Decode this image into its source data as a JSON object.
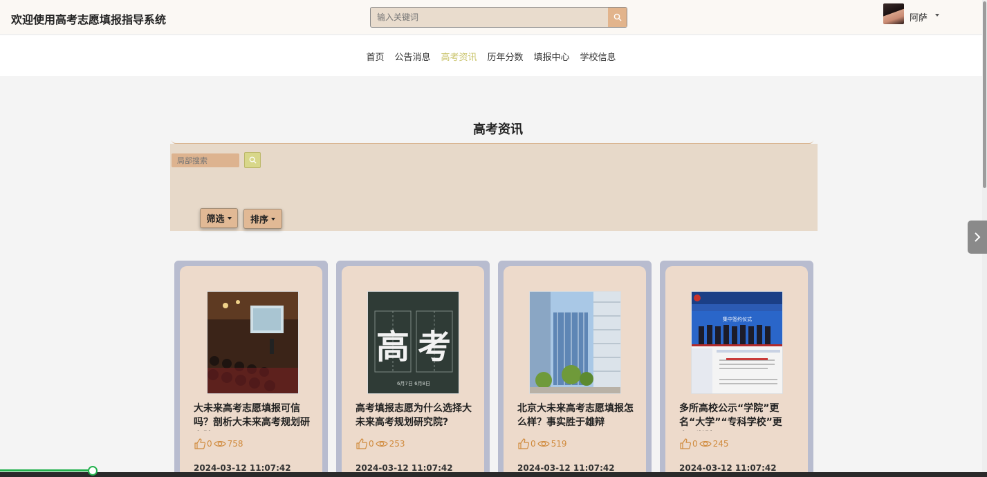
{
  "header": {
    "title": "欢迎使用高考志愿填报指导系统",
    "search_placeholder": "输入关键词",
    "username": "阿萨"
  },
  "nav": {
    "items": [
      "首页",
      "公告消息",
      "高考资讯",
      "历年分数",
      "填报中心",
      "学校信息"
    ],
    "active": "高考资讯"
  },
  "section": {
    "title": "高考资讯",
    "local_search_placeholder": "局部搜索",
    "filter_label": "筛选",
    "sort_label": "排序"
  },
  "cards": [
    {
      "title": "大未来高考志愿填报可信吗？剖析大未来高考规划研究院",
      "likes": "0",
      "views": "758",
      "date": "2024-03-12 11:07:42",
      "image": "lecture-hall-photo"
    },
    {
      "title": "高考填报志愿为什么选择大未来高考规划研究院?",
      "likes": "0",
      "views": "253",
      "date": "2024-03-12 11:07:42",
      "image": "gaokao-calligraphy"
    },
    {
      "title": "北京大未来高考志愿填报怎么样？事实胜于雄辩",
      "likes": "0",
      "views": "519",
      "date": "2024-03-12 11:07:42",
      "image": "campus-buildings-photo"
    },
    {
      "title": "多所高校公示“学院”更名“大学”“专科学校”更名“学院”",
      "likes": "0",
      "views": "245",
      "date": "2024-03-12 11:07:42",
      "image": "university-website-screenshot"
    }
  ],
  "thumb_texts": {
    "calligraphy": [
      "高",
      "考"
    ],
    "calligraphy_dates": "6月7日 6月8日",
    "banner": "集中签约仪式"
  },
  "colors": {
    "accent_nav_active": "#c9c36a",
    "panel_bg": "#e7d9c9",
    "card_bg": "#eddacb",
    "card_border": "#b8bccf",
    "stat_color": "#d08a3c"
  }
}
